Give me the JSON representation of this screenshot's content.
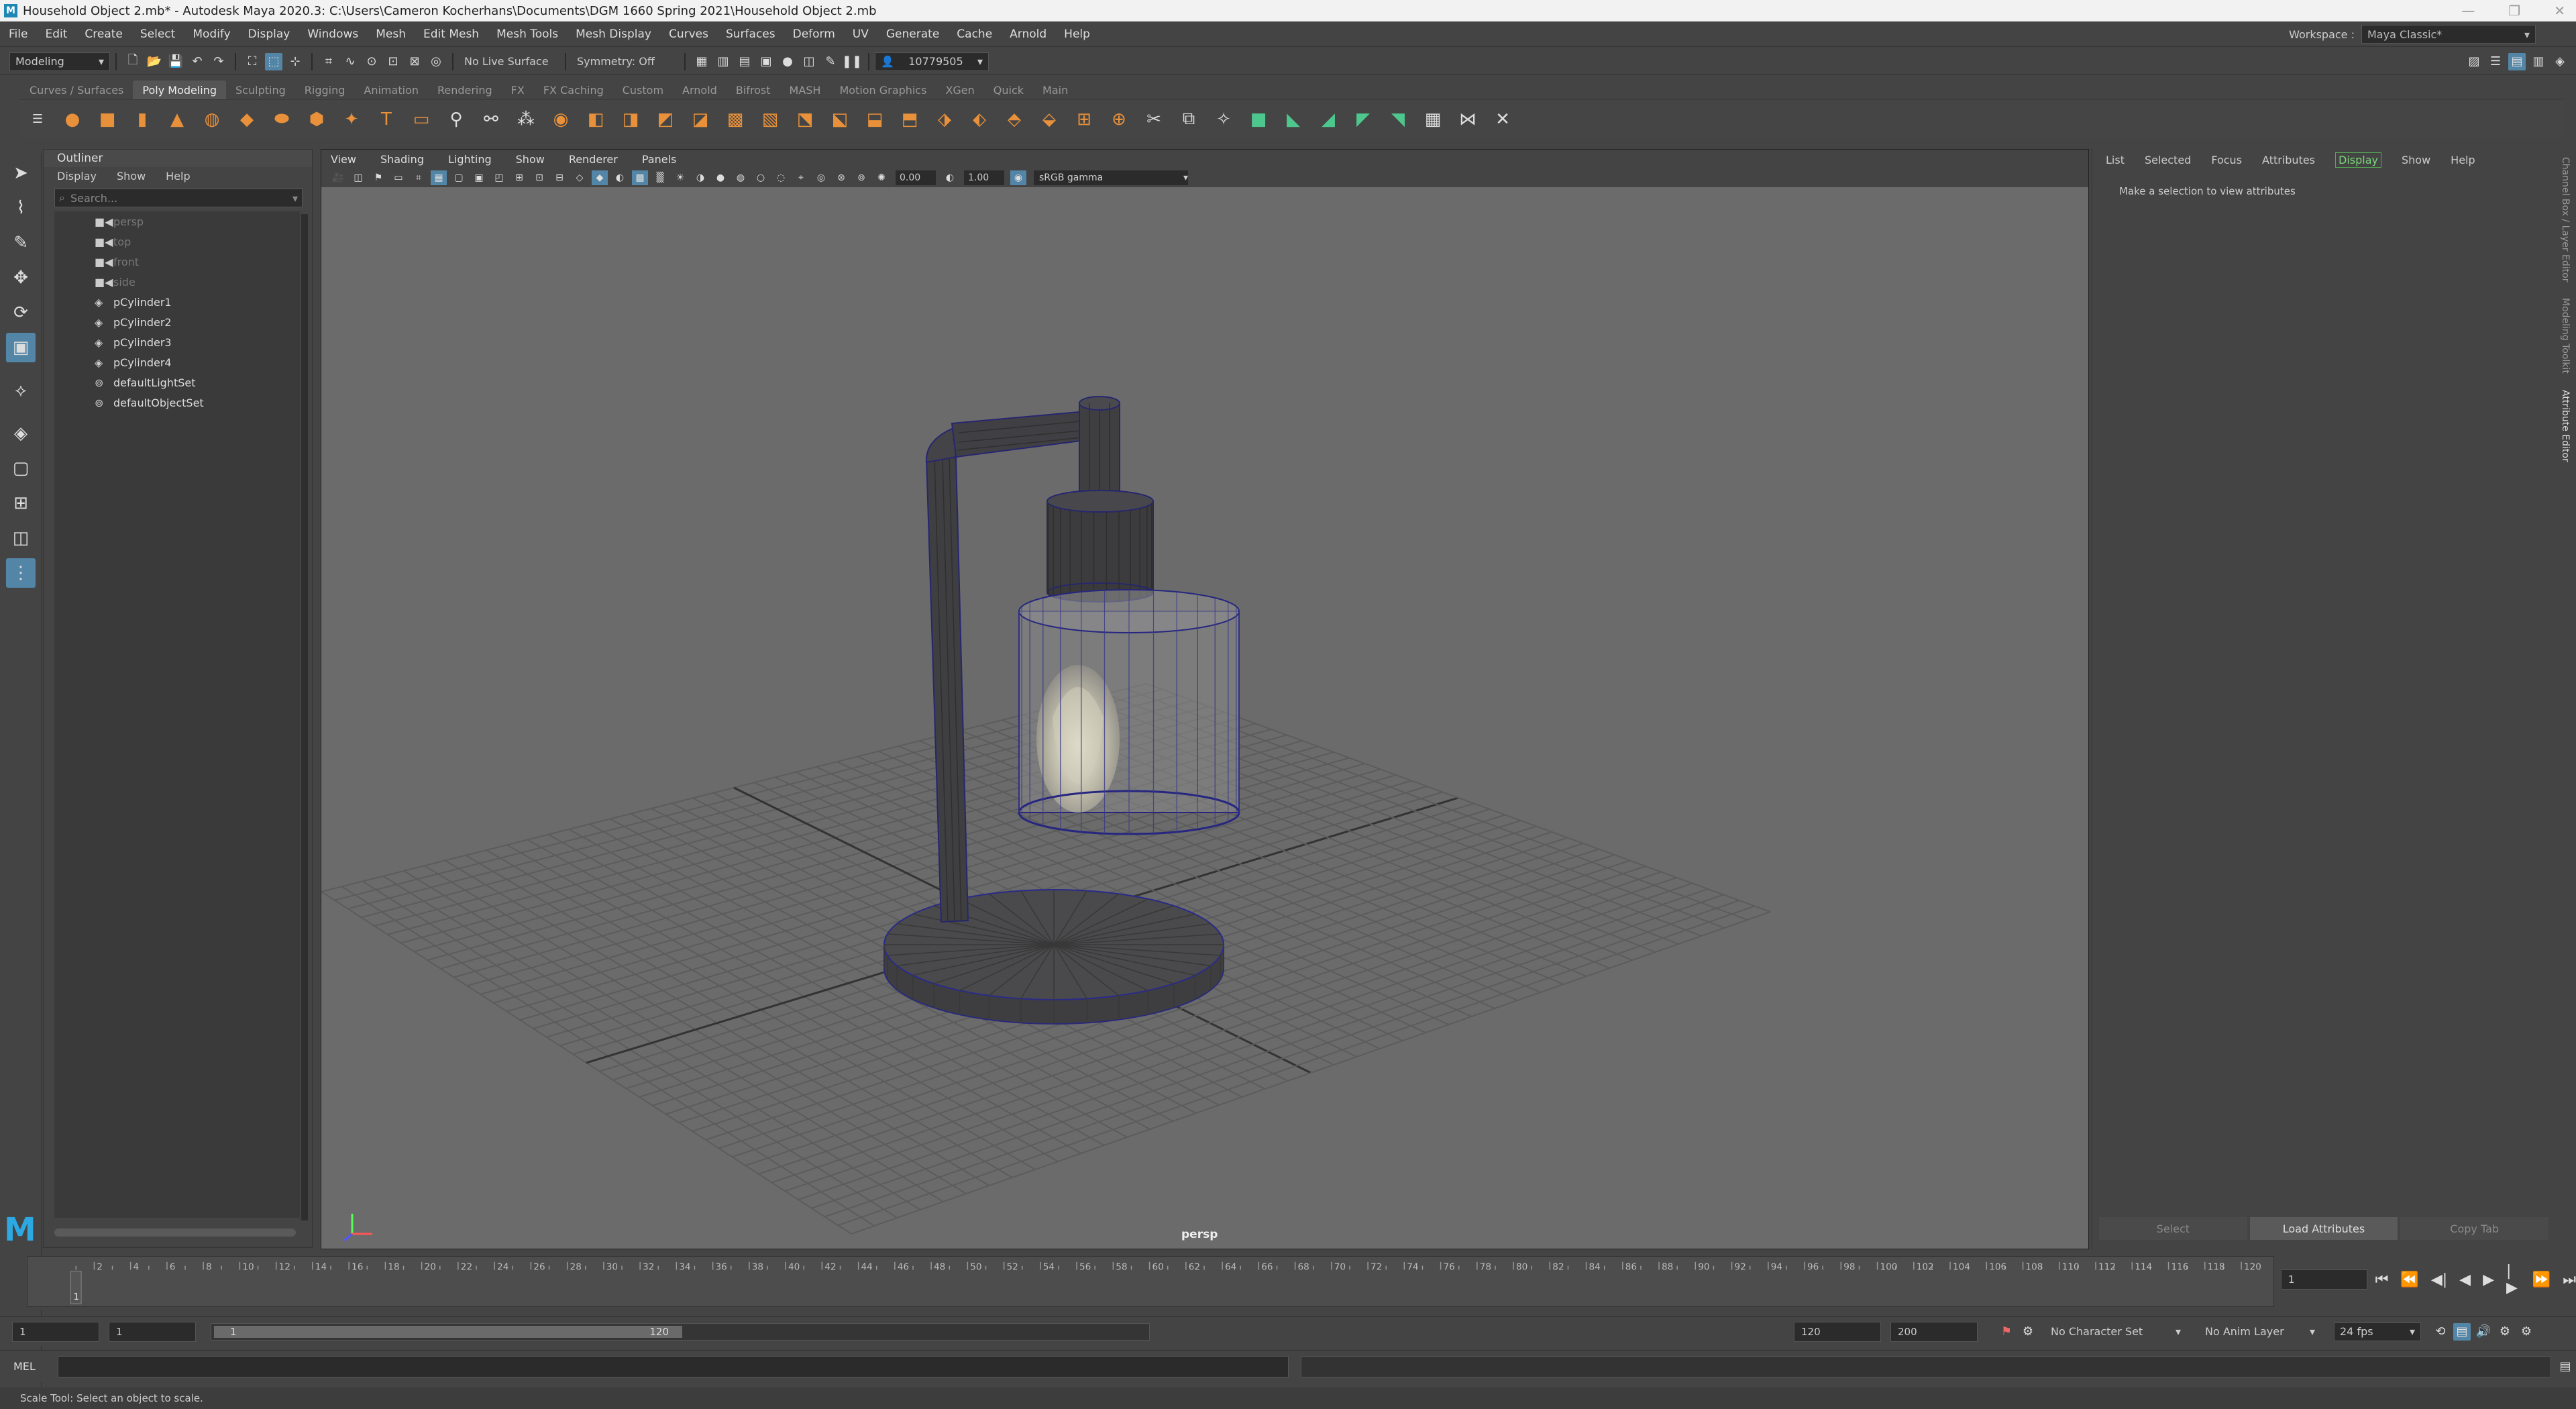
{
  "window": {
    "title": "Household Object 2.mb* - Autodesk Maya 2020.3: C:\\Users\\Cameron Kocherhans\\Documents\\DGM 1660 Spring 2021\\Household Object 2.mb",
    "app_letter": "M"
  },
  "menubar": {
    "items": [
      "File",
      "Edit",
      "Create",
      "Select",
      "Modify",
      "Display",
      "Windows",
      "Mesh",
      "Edit Mesh",
      "Mesh Tools",
      "Mesh Display",
      "Curves",
      "Surfaces",
      "Deform",
      "UV",
      "Generate",
      "Cache",
      "Arnold",
      "Help"
    ],
    "workspace_label": "Workspace :",
    "workspace_value": "Maya Classic*"
  },
  "statusline": {
    "menuset": "Modeling",
    "live_surface": "No Live Surface",
    "symmetry": "Symmetry: Off",
    "account": "10779505"
  },
  "shelf": {
    "tabs": [
      "Curves / Surfaces",
      "Poly Modeling",
      "Sculpting",
      "Rigging",
      "Animation",
      "Rendering",
      "FX",
      "FX Caching",
      "Custom",
      "Arnold",
      "Bifrost",
      "MASH",
      "Motion Graphics",
      "XGen",
      "Quick",
      "Main"
    ],
    "active_tab": "Poly Modeling"
  },
  "outliner": {
    "title": "Outliner",
    "menu": [
      "Display",
      "Show",
      "Help"
    ],
    "search_placeholder": "Search...",
    "items": [
      {
        "label": "persp",
        "icon": "camera-icon",
        "dim": true
      },
      {
        "label": "top",
        "icon": "camera-icon",
        "dim": true
      },
      {
        "label": "front",
        "icon": "camera-icon",
        "dim": true
      },
      {
        "label": "side",
        "icon": "camera-icon",
        "dim": true
      },
      {
        "label": "pCylinder1",
        "icon": "mesh-icon",
        "dim": false
      },
      {
        "label": "pCylinder2",
        "icon": "mesh-icon",
        "dim": false
      },
      {
        "label": "pCylinder3",
        "icon": "mesh-icon",
        "dim": false
      },
      {
        "label": "pCylinder4",
        "icon": "mesh-icon",
        "dim": false
      },
      {
        "label": "defaultLightSet",
        "icon": "set-icon",
        "dim": false
      },
      {
        "label": "defaultObjectSet",
        "icon": "set-icon",
        "dim": false
      }
    ]
  },
  "viewport": {
    "menu": [
      "View",
      "Shading",
      "Lighting",
      "Show",
      "Renderer",
      "Panels"
    ],
    "exposure": "0.00",
    "gamma": "1.00",
    "colorspace": "sRGB gamma",
    "camera_label": "persp"
  },
  "attribute_editor": {
    "menu": [
      "List",
      "Selected",
      "Focus",
      "Attributes",
      "Display",
      "Show",
      "Help"
    ],
    "active_menu": "Display",
    "message": "Make a selection to view attributes",
    "buttons": [
      "Select",
      "Load Attributes",
      "Copy Tab"
    ],
    "side_tabs": [
      "Channel Box / Layer Editor",
      "Modeling Toolkit",
      "Attribute Editor"
    ]
  },
  "timeslider": {
    "ticks": [
      "2",
      "4",
      "6",
      "8",
      "10",
      "12",
      "14",
      "16",
      "18",
      "20",
      "22",
      "24",
      "26",
      "28",
      "30",
      "32",
      "34",
      "36",
      "38",
      "40",
      "42",
      "44",
      "46",
      "48",
      "50",
      "52",
      "54",
      "56",
      "58",
      "60",
      "62",
      "64",
      "66",
      "68",
      "70",
      "72",
      "74",
      "76",
      "78",
      "80",
      "82",
      "84",
      "86",
      "88",
      "90",
      "92",
      "94",
      "96",
      "98",
      "100",
      "102",
      "104",
      "106",
      "108",
      "110",
      "112",
      "114",
      "116",
      "118",
      "120"
    ],
    "current_frame_marker": "1",
    "current_frame_field": "1"
  },
  "range": {
    "start": "1",
    "playback_start": "1",
    "slider_start": "1",
    "slider_end": "120",
    "playback_end": "120",
    "end": "200",
    "character_set": "No Character Set",
    "anim_layer": "No Anim Layer",
    "fps": "24 fps"
  },
  "commandline": {
    "label": "MEL"
  },
  "helpline": {
    "text": "Scale Tool: Select an object to scale."
  }
}
